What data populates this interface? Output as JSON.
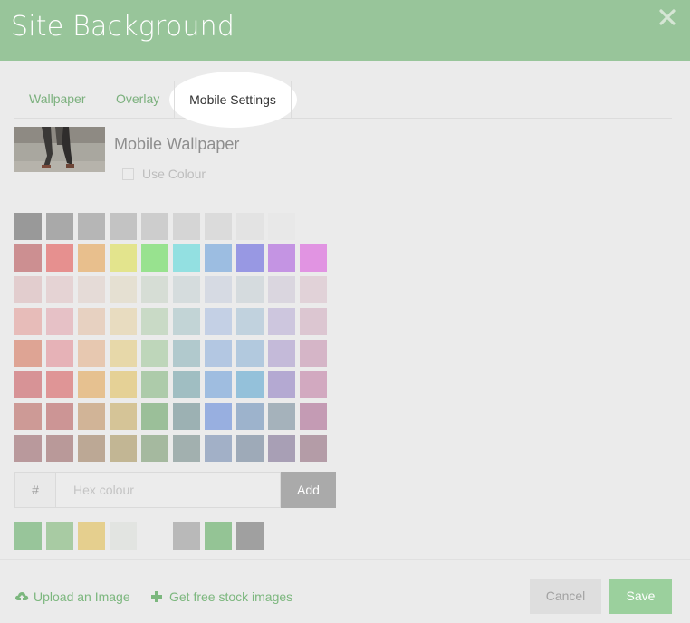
{
  "header": {
    "title": "Site Background"
  },
  "tabs": [
    {
      "label": "Wallpaper",
      "active": false
    },
    {
      "label": "Overlay",
      "active": false
    },
    {
      "label": "Mobile Settings",
      "active": true
    }
  ],
  "mobile": {
    "label": "Mobile Wallpaper",
    "use_colour_label": "Use Colour",
    "use_colour_checked": false
  },
  "palette": [
    [
      "#999999",
      "#a9a9a9",
      "#b6b6b6",
      "#c3c3c3",
      "#cdcdcd",
      "#d5d5d5",
      "#dbdbdb",
      "#e3e3e3",
      "#e8e8e8",
      "#ebebeb"
    ],
    [
      "#cc8f91",
      "#e6908f",
      "#e8bf8d",
      "#e3e48d",
      "#98e28f",
      "#93e0e1",
      "#9cbde1",
      "#9898e3",
      "#c494e3",
      "#e194e2"
    ],
    [
      "#e2cdce",
      "#e5d3d4",
      "#e5dbd7",
      "#e5e0d2",
      "#d6ddd5",
      "#d5dcdd",
      "#d6dae3",
      "#d5dbde",
      "#dad6df",
      "#e1d2d8"
    ],
    [
      "#e7bcb9",
      "#e6c1c6",
      "#e7d1c1",
      "#e8dcc0",
      "#c9dac6",
      "#c2d4d6",
      "#c4d0e5",
      "#c1d2de",
      "#cdc6de",
      "#dcc6d1"
    ],
    [
      "#dea494",
      "#e6b2b7",
      "#e7c8b0",
      "#e7d8a9",
      "#bed6ba",
      "#b1c9cd",
      "#b3c7e2",
      "#b2c9de",
      "#c4bad9",
      "#d5b5c7"
    ],
    [
      "#d79396",
      "#df9596",
      "#e6c190",
      "#e5d196",
      "#adcbaa",
      "#a0bec2",
      "#9fbde0",
      "#94c1da",
      "#b4a9d2",
      "#d2a9c0"
    ],
    [
      "#cd9a96",
      "#cc9595",
      "#d1b497",
      "#d5c497",
      "#9bbf99",
      "#9cb1b3",
      "#98afe0",
      "#9db3cc",
      "#a5b2bb",
      "#c49bb4"
    ],
    [
      "#b9999c",
      "#b99999",
      "#bca895",
      "#c2b694",
      "#a5b99f",
      "#a2b0af",
      "#a2b0c7",
      "#9eaab8",
      "#a89fb5",
      "#b49ca7"
    ]
  ],
  "hex": {
    "prefix": "#",
    "placeholder": "Hex colour",
    "add_label": "Add"
  },
  "recent": [
    "#98c59a",
    "#a8cba3",
    "#e5cf8e",
    "#e2e4e1",
    "#ebebeb",
    "#b9b9b9",
    "#94c495",
    "#a0a0a0"
  ],
  "footer": {
    "upload_label": "Upload an Image",
    "stock_label": "Get free stock images",
    "cancel_label": "Cancel",
    "save_label": "Save"
  },
  "colors": {
    "accent": "#98c59a",
    "link": "#7cb77e",
    "save": "#9bd09d"
  }
}
